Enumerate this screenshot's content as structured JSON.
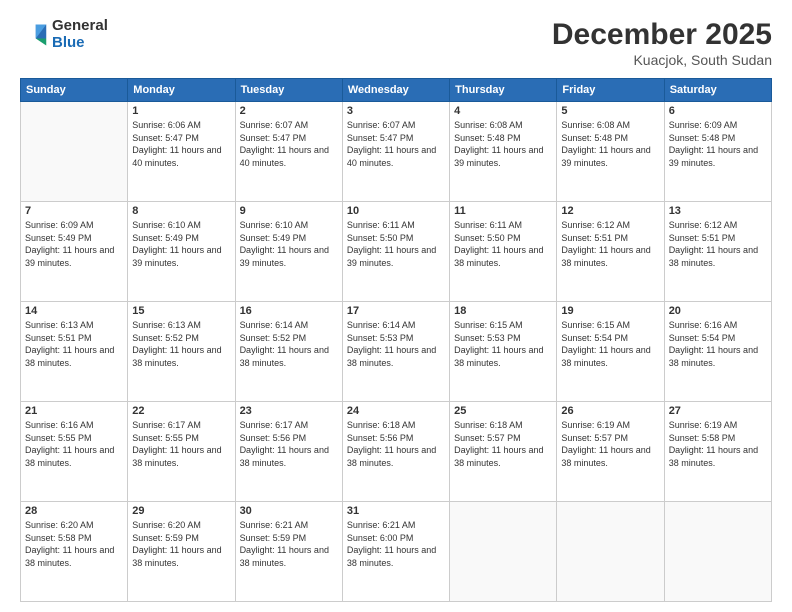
{
  "header": {
    "logo_general": "General",
    "logo_blue": "Blue",
    "month": "December 2025",
    "location": "Kuacjok, South Sudan"
  },
  "weekdays": [
    "Sunday",
    "Monday",
    "Tuesday",
    "Wednesday",
    "Thursday",
    "Friday",
    "Saturday"
  ],
  "weeks": [
    [
      {
        "day": "",
        "sunrise": "",
        "sunset": "",
        "daylight": "",
        "empty": true
      },
      {
        "day": "1",
        "sunrise": "6:06 AM",
        "sunset": "5:47 PM",
        "daylight": "11 hours and 40 minutes."
      },
      {
        "day": "2",
        "sunrise": "6:07 AM",
        "sunset": "5:47 PM",
        "daylight": "11 hours and 40 minutes."
      },
      {
        "day": "3",
        "sunrise": "6:07 AM",
        "sunset": "5:47 PM",
        "daylight": "11 hours and 40 minutes."
      },
      {
        "day": "4",
        "sunrise": "6:08 AM",
        "sunset": "5:48 PM",
        "daylight": "11 hours and 39 minutes."
      },
      {
        "day": "5",
        "sunrise": "6:08 AM",
        "sunset": "5:48 PM",
        "daylight": "11 hours and 39 minutes."
      },
      {
        "day": "6",
        "sunrise": "6:09 AM",
        "sunset": "5:48 PM",
        "daylight": "11 hours and 39 minutes."
      }
    ],
    [
      {
        "day": "7",
        "sunrise": "6:09 AM",
        "sunset": "5:49 PM",
        "daylight": "11 hours and 39 minutes."
      },
      {
        "day": "8",
        "sunrise": "6:10 AM",
        "sunset": "5:49 PM",
        "daylight": "11 hours and 39 minutes."
      },
      {
        "day": "9",
        "sunrise": "6:10 AM",
        "sunset": "5:49 PM",
        "daylight": "11 hours and 39 minutes."
      },
      {
        "day": "10",
        "sunrise": "6:11 AM",
        "sunset": "5:50 PM",
        "daylight": "11 hours and 39 minutes."
      },
      {
        "day": "11",
        "sunrise": "6:11 AM",
        "sunset": "5:50 PM",
        "daylight": "11 hours and 38 minutes."
      },
      {
        "day": "12",
        "sunrise": "6:12 AM",
        "sunset": "5:51 PM",
        "daylight": "11 hours and 38 minutes."
      },
      {
        "day": "13",
        "sunrise": "6:12 AM",
        "sunset": "5:51 PM",
        "daylight": "11 hours and 38 minutes."
      }
    ],
    [
      {
        "day": "14",
        "sunrise": "6:13 AM",
        "sunset": "5:51 PM",
        "daylight": "11 hours and 38 minutes."
      },
      {
        "day": "15",
        "sunrise": "6:13 AM",
        "sunset": "5:52 PM",
        "daylight": "11 hours and 38 minutes."
      },
      {
        "day": "16",
        "sunrise": "6:14 AM",
        "sunset": "5:52 PM",
        "daylight": "11 hours and 38 minutes."
      },
      {
        "day": "17",
        "sunrise": "6:14 AM",
        "sunset": "5:53 PM",
        "daylight": "11 hours and 38 minutes."
      },
      {
        "day": "18",
        "sunrise": "6:15 AM",
        "sunset": "5:53 PM",
        "daylight": "11 hours and 38 minutes."
      },
      {
        "day": "19",
        "sunrise": "6:15 AM",
        "sunset": "5:54 PM",
        "daylight": "11 hours and 38 minutes."
      },
      {
        "day": "20",
        "sunrise": "6:16 AM",
        "sunset": "5:54 PM",
        "daylight": "11 hours and 38 minutes."
      }
    ],
    [
      {
        "day": "21",
        "sunrise": "6:16 AM",
        "sunset": "5:55 PM",
        "daylight": "11 hours and 38 minutes."
      },
      {
        "day": "22",
        "sunrise": "6:17 AM",
        "sunset": "5:55 PM",
        "daylight": "11 hours and 38 minutes."
      },
      {
        "day": "23",
        "sunrise": "6:17 AM",
        "sunset": "5:56 PM",
        "daylight": "11 hours and 38 minutes."
      },
      {
        "day": "24",
        "sunrise": "6:18 AM",
        "sunset": "5:56 PM",
        "daylight": "11 hours and 38 minutes."
      },
      {
        "day": "25",
        "sunrise": "6:18 AM",
        "sunset": "5:57 PM",
        "daylight": "11 hours and 38 minutes."
      },
      {
        "day": "26",
        "sunrise": "6:19 AM",
        "sunset": "5:57 PM",
        "daylight": "11 hours and 38 minutes."
      },
      {
        "day": "27",
        "sunrise": "6:19 AM",
        "sunset": "5:58 PM",
        "daylight": "11 hours and 38 minutes."
      }
    ],
    [
      {
        "day": "28",
        "sunrise": "6:20 AM",
        "sunset": "5:58 PM",
        "daylight": "11 hours and 38 minutes."
      },
      {
        "day": "29",
        "sunrise": "6:20 AM",
        "sunset": "5:59 PM",
        "daylight": "11 hours and 38 minutes."
      },
      {
        "day": "30",
        "sunrise": "6:21 AM",
        "sunset": "5:59 PM",
        "daylight": "11 hours and 38 minutes."
      },
      {
        "day": "31",
        "sunrise": "6:21 AM",
        "sunset": "6:00 PM",
        "daylight": "11 hours and 38 minutes."
      },
      {
        "day": "",
        "sunrise": "",
        "sunset": "",
        "daylight": "",
        "empty": true
      },
      {
        "day": "",
        "sunrise": "",
        "sunset": "",
        "daylight": "",
        "empty": true
      },
      {
        "day": "",
        "sunrise": "",
        "sunset": "",
        "daylight": "",
        "empty": true
      }
    ]
  ]
}
